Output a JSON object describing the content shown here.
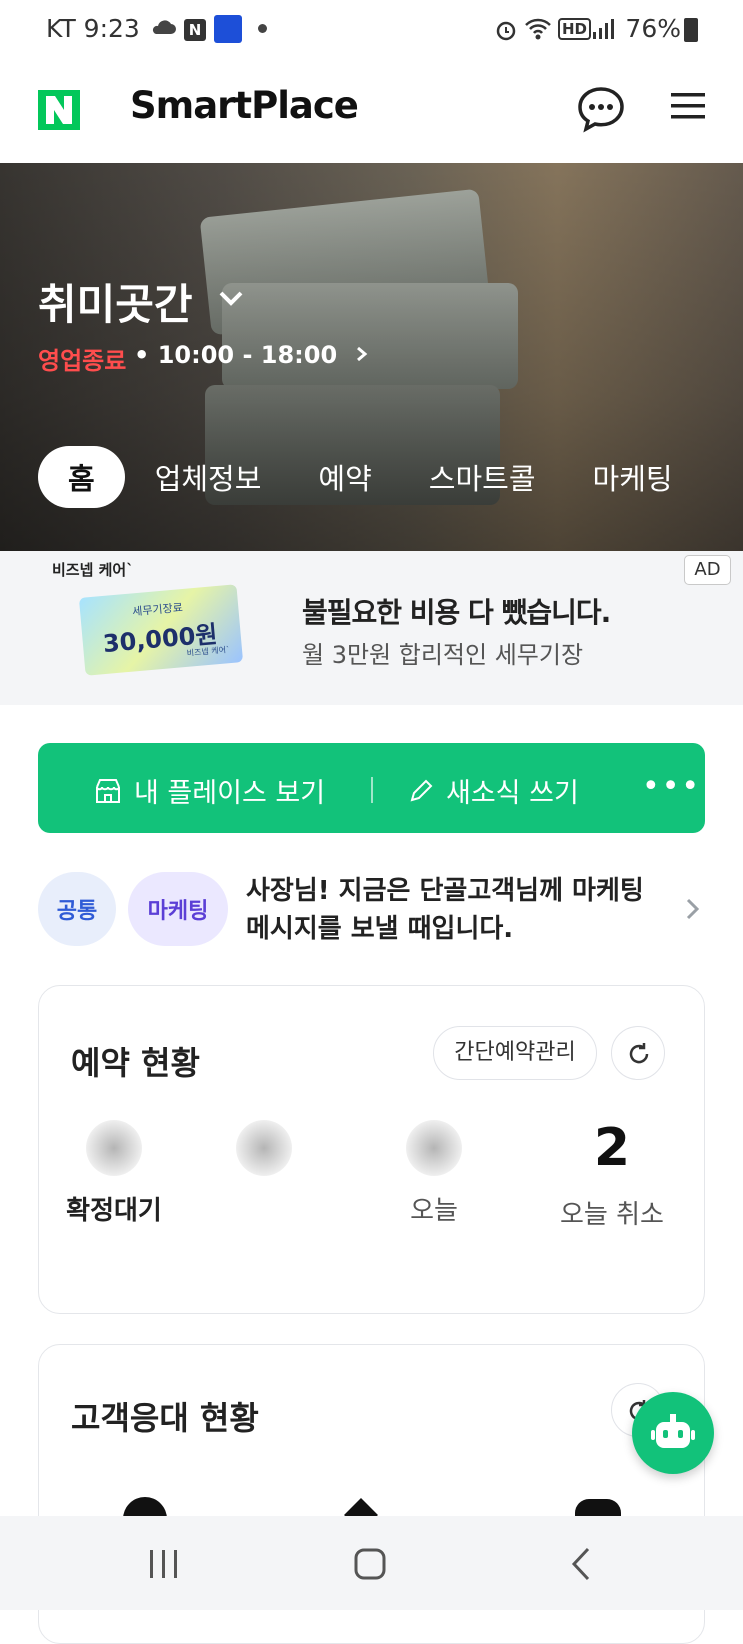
{
  "status_bar": {
    "time": "KT 9:23",
    "battery": "76%"
  },
  "header": {
    "brand": "SmartPlace"
  },
  "hero": {
    "place_name": "취미곳간",
    "open_status": "영업종료",
    "hours": "• 10:00 - 18:00",
    "tabs": [
      {
        "label": "홈"
      },
      {
        "label": "업체정보"
      },
      {
        "label": "예약"
      },
      {
        "label": "스마트콜"
      },
      {
        "label": "마케팅"
      }
    ]
  },
  "ad": {
    "brand": "비즈넵 케어`",
    "ticket_small": "세무기장료",
    "ticket_amount": "30,000원",
    "ticket_brand": "비즈넵 케어`",
    "headline": "불필요한 비용 다 뺐습니다.",
    "subline": "월 3만원 합리적인 세무기장",
    "badge": "AD"
  },
  "actions": {
    "view_place": "내 플레이스 보기",
    "write_news": "새소식 쓰기",
    "more": "•••"
  },
  "notice": {
    "tag_common": "공통",
    "tag_marketing": "마케팅",
    "text": "사장님! 지금은 단골고객님께 마케팅 메시지를 보낼 때입니다."
  },
  "reservation_card": {
    "title": "예약 현황",
    "simple_manage": "간단예약관리",
    "stats": [
      {
        "label": "확정대기",
        "value": ""
      },
      {
        "label": "",
        "value": ""
      },
      {
        "label": "오늘",
        "value": ""
      },
      {
        "label": "오늘 취소",
        "value": "2"
      }
    ]
  },
  "service_card": {
    "title": "고객응대 현황"
  }
}
